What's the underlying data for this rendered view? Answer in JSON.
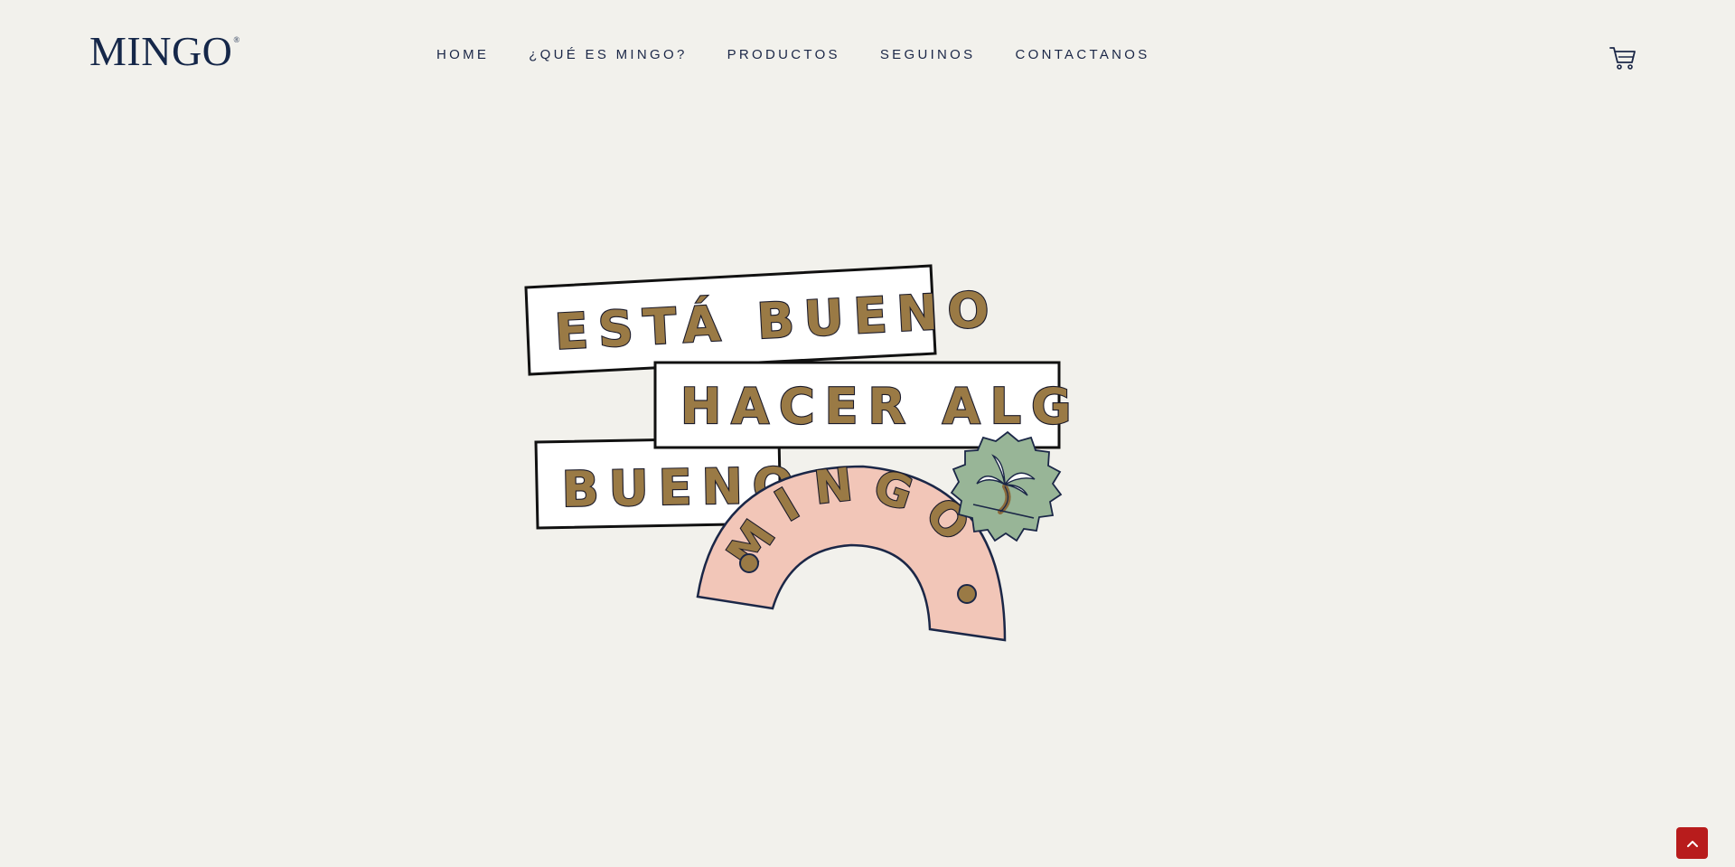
{
  "brand": {
    "logo_text": "MINGO",
    "logo_mark": "®"
  },
  "nav": {
    "items": [
      {
        "label": "HOME"
      },
      {
        "label": "¿QUÉ ES MINGO?"
      },
      {
        "label": "PRODUCTOS"
      },
      {
        "label": "SEGUINOS"
      },
      {
        "label": "CONTACTANOS"
      }
    ]
  },
  "cart": {
    "icon": "cart-icon"
  },
  "hero": {
    "line1": "ESTÁ BUENO",
    "line2": "HACER ALGO",
    "line3": "BUENO",
    "arc_word": "MINGO",
    "badge_icon": "palm-tree-icon"
  },
  "scroll_top": {
    "icon": "chevron-up-icon"
  },
  "colors": {
    "background": "#f2f1ec",
    "navy": "#1b2747",
    "gold": "#9a7a45",
    "pink": "#f2c6b8",
    "sage": "#98b597",
    "red": "#b81c1c"
  }
}
